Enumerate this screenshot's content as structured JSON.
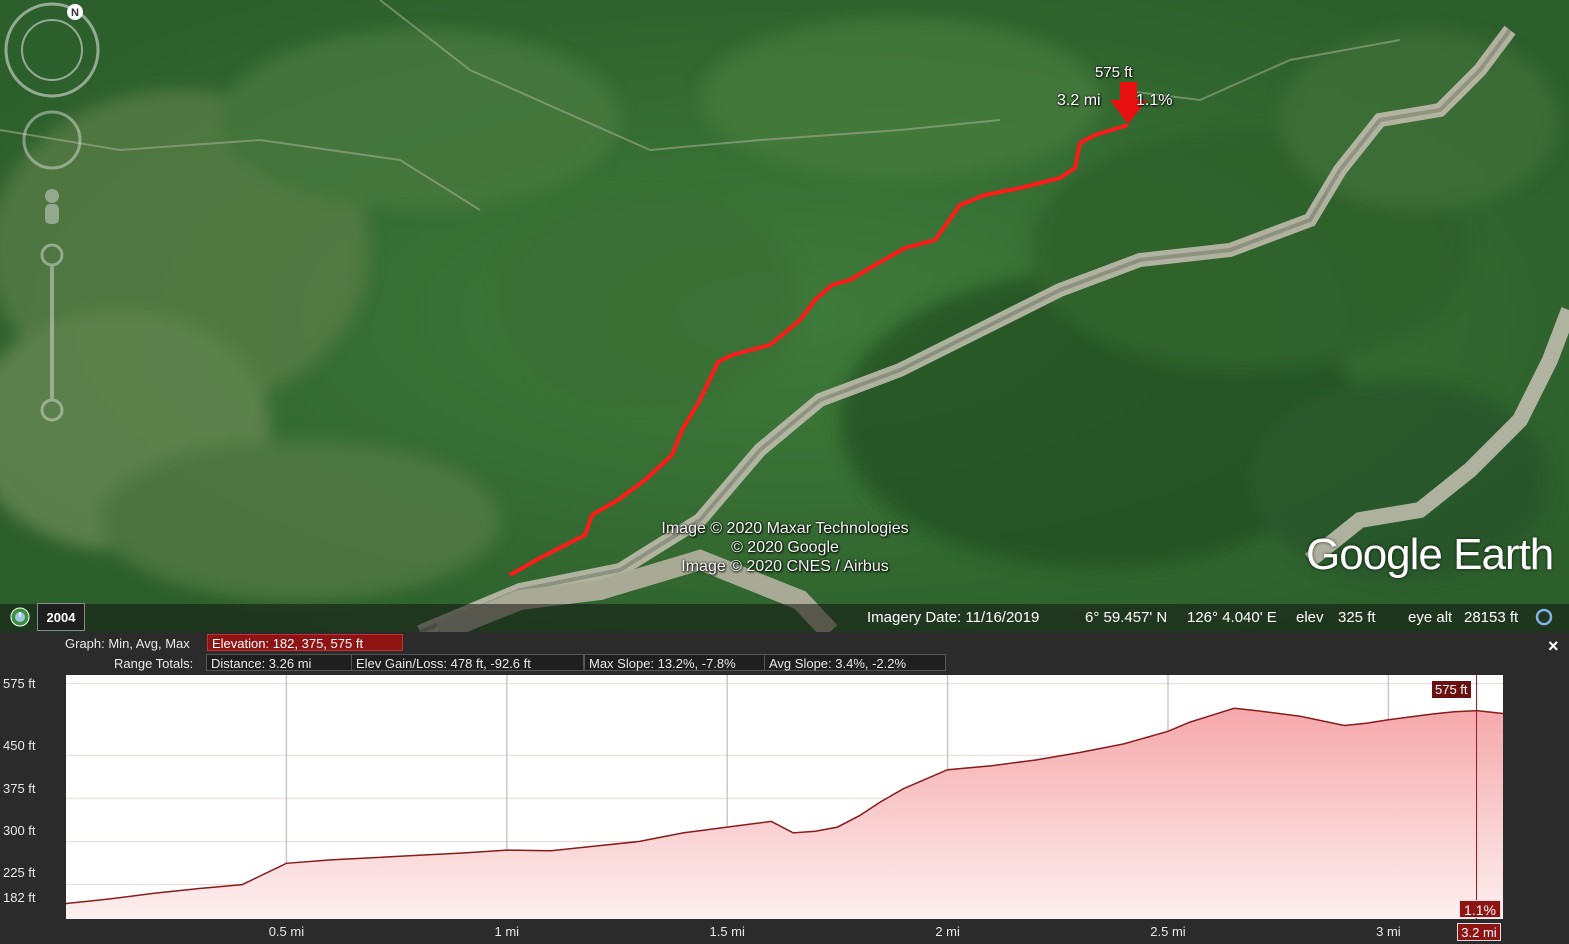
{
  "map": {
    "marker": {
      "elevation": "575 ft",
      "distance": "3.2 mi",
      "slope": "1.1%"
    },
    "credits": [
      "Image © 2020 Maxar Technologies",
      "© 2020 Google",
      "Image © 2020 CNES / Airbus"
    ],
    "logo": "Google Earth",
    "colors": {
      "path": "#ff1a1a",
      "marker": "#e81010"
    }
  },
  "statusbar": {
    "year": "2004",
    "imagery_date": "Imagery Date: 11/16/2019",
    "lat": "6° 59.457' N",
    "lon": "126° 4.040' E",
    "elev_label": "elev",
    "elev_value": "325 ft",
    "eye_alt_label": "eye alt",
    "eye_alt_value": "28153 ft"
  },
  "profile": {
    "graph_label": "Graph: Min, Avg, Max",
    "elevation_stats": "Elevation: 182, 375, 575 ft",
    "range_label": "Range Totals:",
    "distance": "Distance: 3.26 mi",
    "elev_gain_loss": "Elev Gain/Loss: 478 ft, -92.6 ft",
    "max_slope": "Max Slope: 13.2%, -7.8%",
    "avg_slope": "Avg Slope: 3.4%, -2.2%",
    "close": "×",
    "cursor_distance": "3.2 mi",
    "cursor_slope": "1.1%",
    "cursor_elev": "575 ft"
  },
  "chart_data": {
    "type": "area",
    "xlabel": "",
    "ylabel": "",
    "xlim": [
      0,
      3.26
    ],
    "ylim": [
      165,
      590
    ],
    "x_ticks": [
      "0.5 mi",
      "1 mi",
      "1.5 mi",
      "2 mi",
      "2.5 mi",
      "3 mi"
    ],
    "y_ticks": [
      "575 ft",
      "450 ft",
      "375 ft",
      "300 ft",
      "225 ft",
      "182 ft"
    ],
    "y_tick_values": [
      575,
      450,
      375,
      300,
      225,
      182
    ],
    "colors": {
      "line": "#8b1a1a",
      "fill_top": "#f5a8ab",
      "fill_bottom": "#fdf0f0"
    },
    "series": [
      {
        "x": [
          0,
          0.05,
          0.1,
          0.2,
          0.3,
          0.4,
          0.5,
          0.6,
          0.7,
          0.8,
          0.9,
          1.0,
          1.1,
          1.2,
          1.3,
          1.4,
          1.5,
          1.55,
          1.6,
          1.65,
          1.7,
          1.75,
          1.8,
          1.85,
          1.9,
          2.0,
          2.1,
          2.2,
          2.3,
          2.4,
          2.5,
          2.55,
          2.6,
          2.65,
          2.7,
          2.8,
          2.9,
          2.95,
          3.0,
          3.1,
          3.15,
          3.2,
          3.26
        ],
        "y": [
          192,
          196,
          200,
          210,
          218,
          225,
          262,
          268,
          272,
          276,
          280,
          285,
          284,
          292,
          300,
          315,
          325,
          330,
          335,
          315,
          318,
          325,
          345,
          370,
          392,
          425,
          432,
          442,
          455,
          470,
          492,
          508,
          520,
          532,
          528,
          518,
          502,
          506,
          512,
          522,
          526,
          528,
          523
        ]
      }
    ]
  }
}
